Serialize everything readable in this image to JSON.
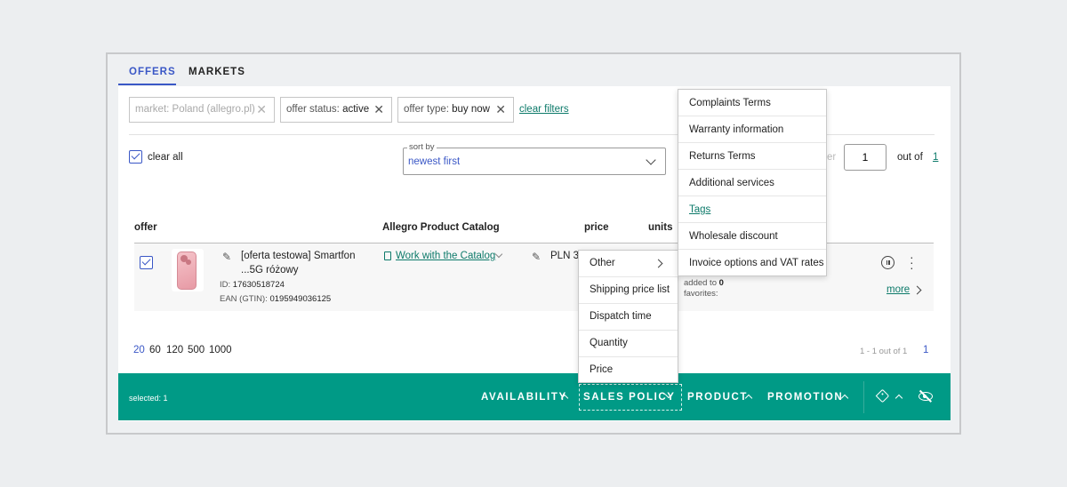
{
  "tabs": [
    {
      "label": "OFFERS",
      "active": true
    },
    {
      "label": "MARKETS",
      "active": false
    }
  ],
  "filters": {
    "market": {
      "text": "market: Poland (allegro.pl)",
      "disabled": true
    },
    "status": {
      "key": "offer status:",
      "value": "active"
    },
    "type": {
      "key": "offer type:",
      "value": "buy now"
    },
    "clear_label": "clear filters"
  },
  "toolbar": {
    "clear_all": "clear all",
    "sort_label": "sort by",
    "sort_value": "newest first",
    "page_hidden": "er",
    "page_value": "1",
    "out_of": "out of",
    "page_total": "1"
  },
  "columns": {
    "offer": "offer",
    "catalog": "Allegro Product Catalog",
    "price": "price",
    "units": "units"
  },
  "row": {
    "title_line1": "[oferta testowa] Smartfon",
    "title_line2": "...5G różowy",
    "id_label": "ID:",
    "id_value": "17630518724",
    "ean_label": "EAN (GTIN):",
    "ean_value": "0195949036125",
    "catalog_link": "Work with the Catalog",
    "price": "PLN 3,",
    "added_to_label": "added to",
    "added_to_value": "0",
    "favorites_label": "favorites:",
    "more": "more"
  },
  "pagination": {
    "per_page": [
      "20",
      "60",
      "120",
      "500",
      "1000"
    ],
    "selected_per_page": "20",
    "info": "1 - 1 out of 1",
    "current_page": "1"
  },
  "bottom_bar": {
    "selected": "selected: 1",
    "availability": "AVAILABILITY",
    "sales_policy": "SALES POLICY",
    "product": "PRODUCT",
    "promotion": "PROMOTION"
  },
  "sales_policy_menu": [
    "Other",
    "Shipping price list",
    "Dispatch time",
    "Quantity",
    "Price"
  ],
  "other_submenu": [
    "Complaints Terms",
    "Warranty information",
    "Returns Terms",
    "Additional services",
    "Tags",
    "Wholesale discount",
    "Invoice options and VAT rates"
  ],
  "colors": {
    "accent": "#3a57c6",
    "bottom_bar": "#009a86",
    "link": "#0d7a6a"
  },
  "icons": [
    "close-icon",
    "chevron-down-icon",
    "pencil-icon",
    "document-icon",
    "pause-icon",
    "kebab-icon",
    "chevron-right-icon",
    "chevron-up-icon",
    "tag-icon",
    "eye-off-icon",
    "checkbox-icon"
  ]
}
